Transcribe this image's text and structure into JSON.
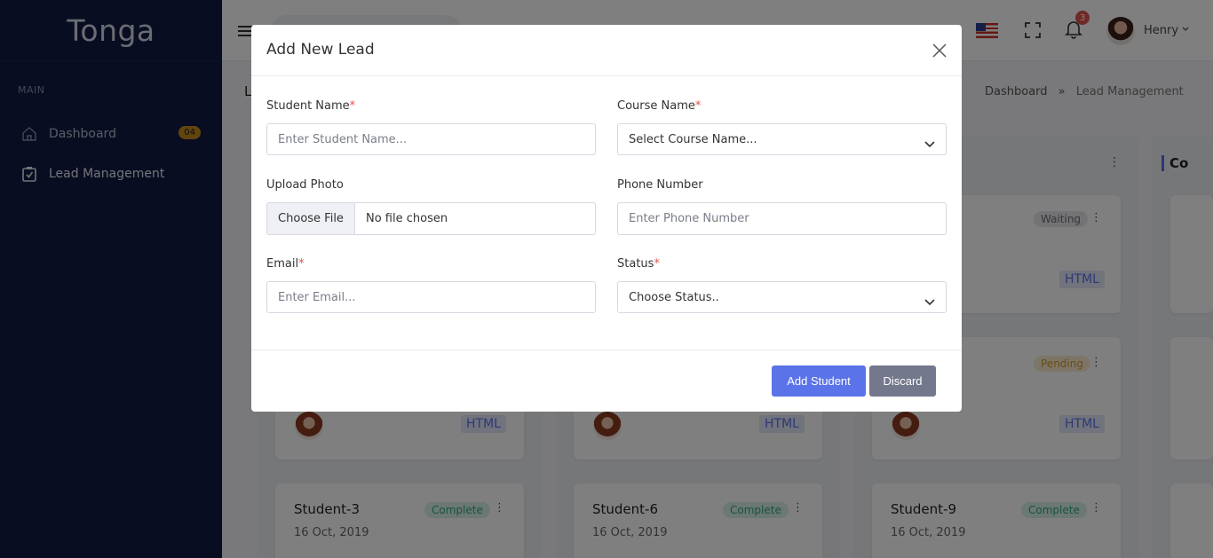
{
  "app": {
    "brand": "Tonga"
  },
  "sidebar": {
    "section_title": "MAIN",
    "items": [
      {
        "label": "Dashboard",
        "icon": "home-icon",
        "badge": "04"
      },
      {
        "label": "Lead Management",
        "icon": "checkbox-icon"
      }
    ]
  },
  "topbar": {
    "notifications_count": "3",
    "user_name": "Henry"
  },
  "page": {
    "title": "L",
    "breadcrumb": [
      "Dashboard",
      "Lead Management"
    ],
    "breadcrumb_separator": "»"
  },
  "board": {
    "partial_column_title": "Co",
    "cards": [
      {
        "name": "Student-3",
        "date": "16 Oct, 2019",
        "status": "Complete"
      },
      {
        "name": "Student-6",
        "date": "16 Oct, 2019",
        "status": "Complete"
      },
      {
        "name": "Student-9",
        "date": "16 Oct, 2019",
        "status": "Complete"
      }
    ],
    "upper_badges": [
      "Waiting",
      "Pending"
    ],
    "tag": "HTML"
  },
  "modal": {
    "title": "Add New Lead",
    "student_name": {
      "label": "Student Name",
      "required": "*",
      "placeholder": "Enter Student Name..."
    },
    "course_name": {
      "label": "Course Name",
      "required": "*",
      "value": "Select Course Name..."
    },
    "upload_photo": {
      "label": "Upload Photo",
      "button": "Choose File",
      "status": "No file chosen"
    },
    "phone_number": {
      "label": "Phone Number",
      "placeholder": "Enter Phone Number"
    },
    "email": {
      "label": "Email",
      "required": "*",
      "placeholder": "Enter Email..."
    },
    "status": {
      "label": "Status",
      "required": "*",
      "value": "Choose Status.."
    },
    "add_button": "Add Student",
    "discard_button": "Discard"
  },
  "colors": {
    "primary": "#5b73e8",
    "sidebar_bg": "#101a44",
    "required": "#e0554d",
    "secondary_btn": "#74788d"
  }
}
